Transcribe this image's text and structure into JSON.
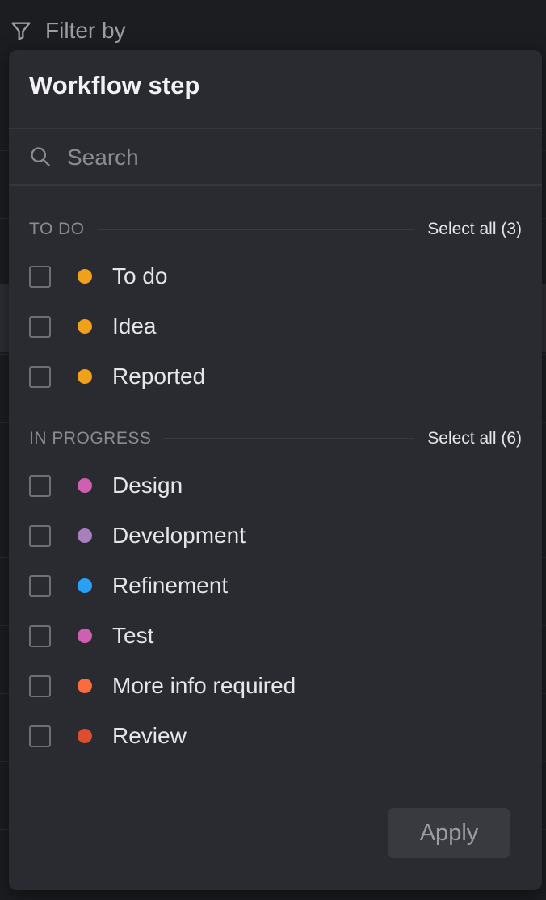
{
  "filter_bar": {
    "label": "Filter by",
    "icon": "filter-icon"
  },
  "popover": {
    "title": "Workflow step",
    "search": {
      "placeholder": "Search",
      "value": "",
      "icon": "search-icon"
    },
    "sections": [
      {
        "label": "TO DO",
        "select_all": "Select all (3)",
        "items": [
          {
            "label": "To do",
            "color": "#f0a019",
            "checked": false
          },
          {
            "label": "Idea",
            "color": "#f0a019",
            "checked": false
          },
          {
            "label": "Reported",
            "color": "#f0a019",
            "checked": false
          }
        ]
      },
      {
        "label": "IN PROGRESS",
        "select_all": "Select all (6)",
        "items": [
          {
            "label": "Design",
            "color": "#cf5fb0",
            "checked": false
          },
          {
            "label": "Development",
            "color": "#a87fbd",
            "checked": false
          },
          {
            "label": "Refinement",
            "color": "#2aa0f5",
            "checked": false
          },
          {
            "label": "Test",
            "color": "#cf5fb0",
            "checked": false
          },
          {
            "label": "More info required",
            "color": "#f96c3d",
            "checked": false
          },
          {
            "label": "Review",
            "color": "#df4c2f",
            "checked": false
          }
        ]
      }
    ],
    "apply_label": "Apply"
  }
}
